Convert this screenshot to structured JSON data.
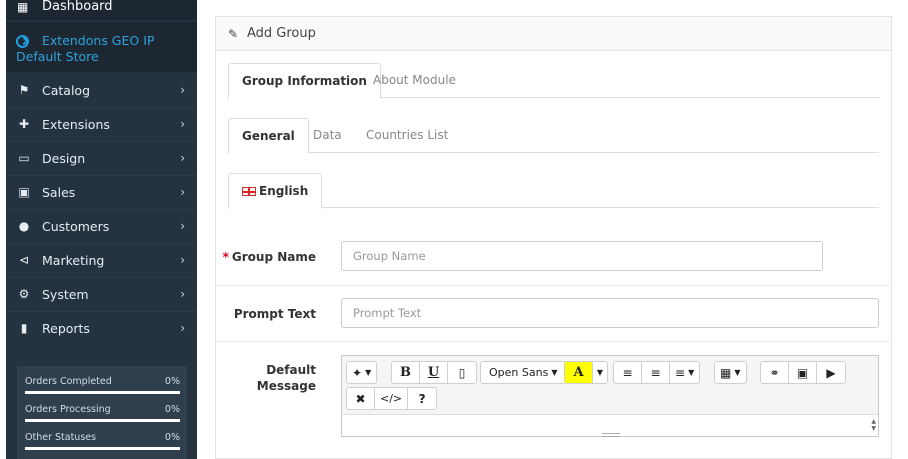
{
  "sidebar": {
    "dashboard": "Dashboard",
    "active_item": "Extendons GEO IP Default Store",
    "items": [
      {
        "label": "Catalog",
        "icon": "tag-icon"
      },
      {
        "label": "Extensions",
        "icon": "puzzle-icon"
      },
      {
        "label": "Design",
        "icon": "monitor-icon"
      },
      {
        "label": "Sales",
        "icon": "cart-icon"
      },
      {
        "label": "Customers",
        "icon": "user-icon"
      },
      {
        "label": "Marketing",
        "icon": "share-icon"
      },
      {
        "label": "System",
        "icon": "gear-icon"
      },
      {
        "label": "Reports",
        "icon": "bar-chart-icon"
      }
    ],
    "stats": [
      {
        "name": "Orders Completed",
        "pct": "0%"
      },
      {
        "name": "Orders Processing",
        "pct": "0%"
      },
      {
        "name": "Other Statuses",
        "pct": "0%"
      }
    ]
  },
  "panel": {
    "title": "Add Group",
    "tabs": [
      "Group Information",
      "About Module"
    ],
    "subtabs": [
      "General",
      "Data",
      "Countries List"
    ],
    "language_tab": "English",
    "fields": {
      "group_name": {
        "label": "Group Name",
        "placeholder": "Group Name",
        "required": "*"
      },
      "prompt_text": {
        "label": "Prompt Text",
        "placeholder": "Prompt Text"
      },
      "default_message": {
        "label": "Default Message"
      }
    },
    "editor": {
      "font_name": "Open Sans",
      "bold": "B",
      "underline": "U",
      "color_letter": "A",
      "code": "</>",
      "help": "?"
    }
  },
  "colors": {
    "sidebar_bg": "#253341",
    "accent": "#2fa3dd",
    "required": "#d9001b"
  }
}
